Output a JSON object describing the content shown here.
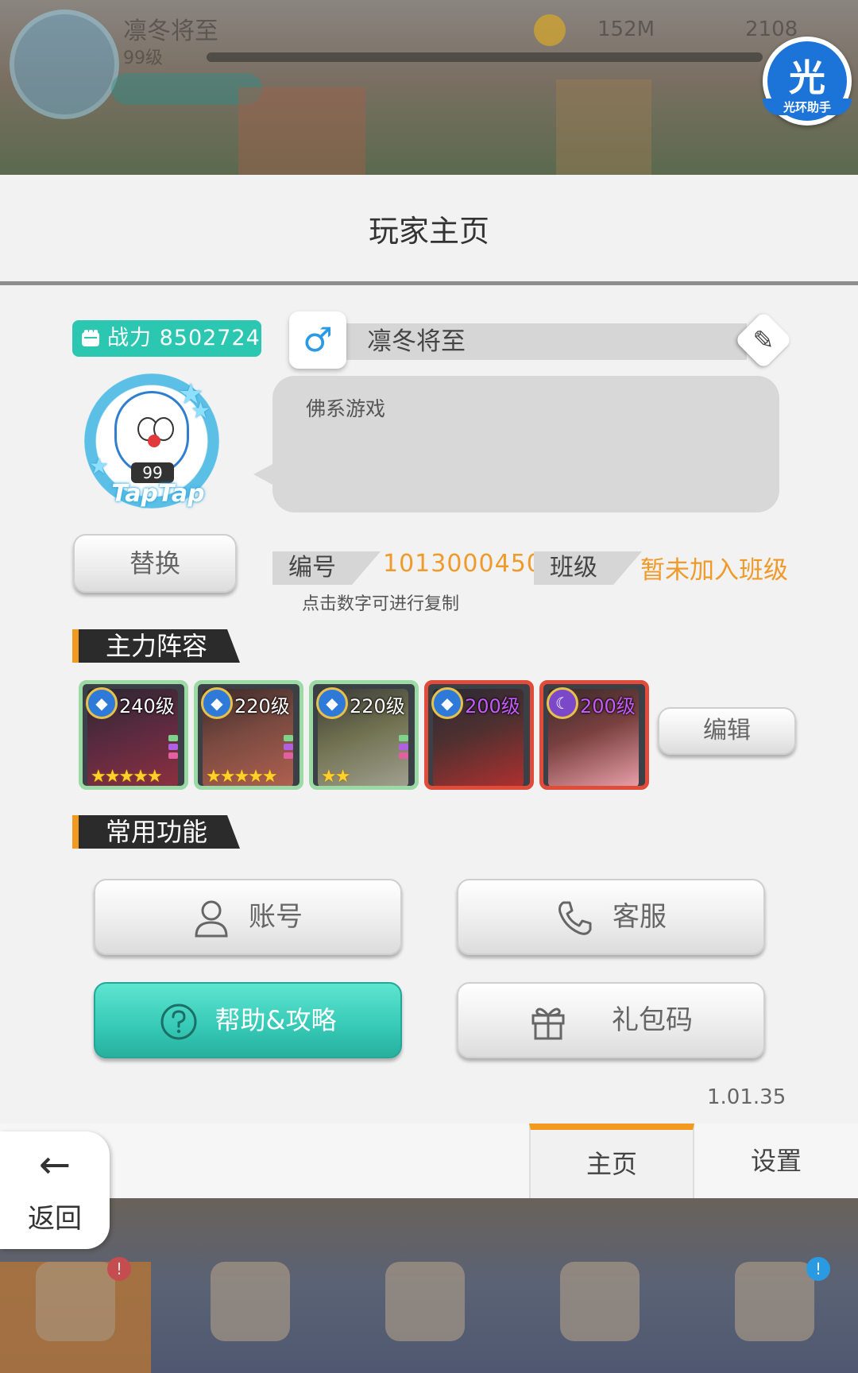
{
  "background": {
    "hud_name": "凛冬将至",
    "hud_level": "99级",
    "hud_coins": "152M",
    "hud_gems": "2108"
  },
  "helper_badge": {
    "glyph": "光",
    "label": "光环助手"
  },
  "dialog": {
    "title": "玩家主页",
    "combat_power_label": "战力",
    "combat_power_value": "8502724",
    "player_name": "凛冬将至",
    "gender_symbol": "♂",
    "signature": "佛系游戏",
    "avatar_level": "99",
    "avatar_brand": "TapTap",
    "replace_button": "替换",
    "id_label": "编号",
    "id_value": "1013000450",
    "class_label": "班级",
    "class_value": "暂未加入班级",
    "copy_tip": "点击数字可进行复制",
    "lineup_title": "主力阵容",
    "heroes": [
      {
        "level": "240级",
        "stars": "★★★★★",
        "frame": "green",
        "emblem": "blue"
      },
      {
        "level": "220级",
        "stars": "★★★★★",
        "frame": "green",
        "emblem": "blue"
      },
      {
        "level": "220级",
        "stars": "★★",
        "frame": "green",
        "emblem": "blue"
      },
      {
        "level": "200级",
        "stars": "",
        "frame": "red",
        "emblem": "blue"
      },
      {
        "level": "200级",
        "stars": "",
        "frame": "red",
        "emblem": "moon"
      }
    ],
    "edit_button": "编辑",
    "functions_title": "常用功能",
    "account_button": "账号",
    "service_button": "客服",
    "help_button": "帮助&攻略",
    "gift_button": "礼包码",
    "version": "1.01.35"
  },
  "tabs": {
    "back_label": "返回",
    "home": "主页",
    "settings": "设置"
  },
  "colors": {
    "accent_teal": "#2cc7b0",
    "accent_orange": "#f29a20",
    "value_orange": "#f09a2a"
  }
}
